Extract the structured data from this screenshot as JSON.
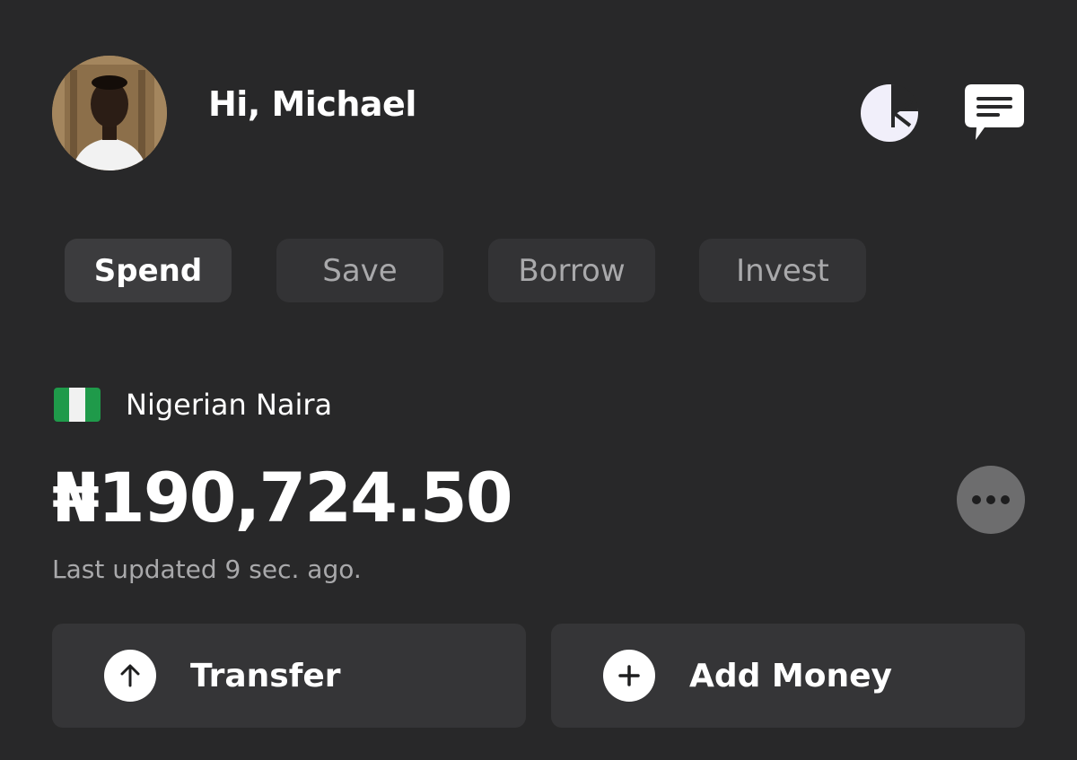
{
  "header": {
    "greeting": "Hi, Michael",
    "icons": [
      "analytics-icon",
      "messages-icon"
    ]
  },
  "tabs": [
    {
      "label": "Spend",
      "active": true
    },
    {
      "label": "Save",
      "active": false
    },
    {
      "label": "Borrow",
      "active": false
    },
    {
      "label": "Invest",
      "active": false
    }
  ],
  "account": {
    "flag": "nigeria-flag-icon",
    "currency_name": "Nigerian Naira",
    "balance": "₦190,724.50",
    "last_updated": "Last updated 9 sec. ago."
  },
  "actions": {
    "transfer_label": "Transfer",
    "add_money_label": "Add Money"
  },
  "colors": {
    "background": "#282829",
    "tab_active": "#3c3c3e",
    "tab_inactive": "#333335",
    "card": "#353537",
    "muted_text": "#a9a9ab",
    "more_button": "#6d6d6e",
    "flag_green": "#1f9a4a"
  }
}
